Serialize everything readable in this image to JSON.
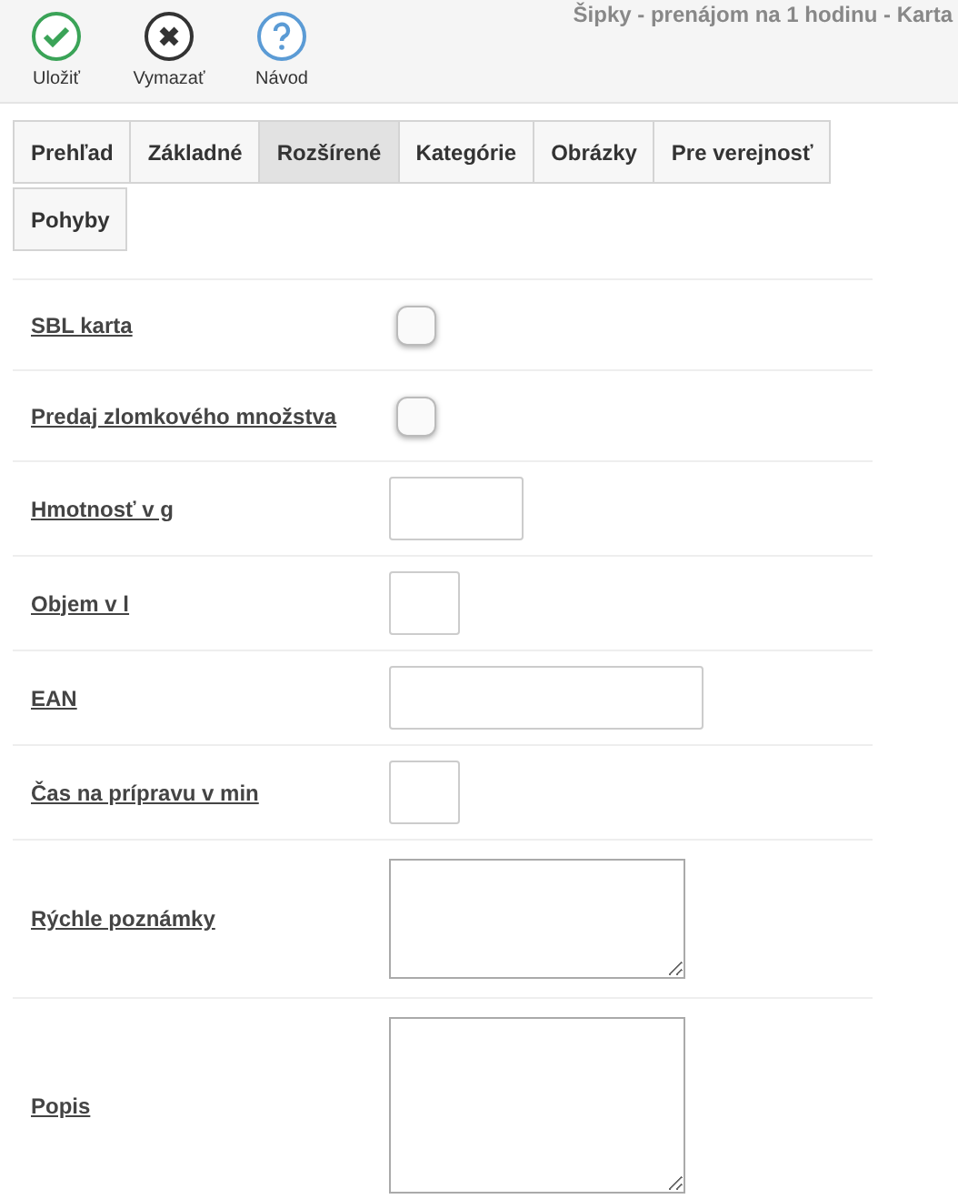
{
  "window": {
    "title": "Šipky - prenájom na 1 hodinu - Karta"
  },
  "toolbar": [
    {
      "kind": "save",
      "label": "Uložiť"
    },
    {
      "kind": "delete",
      "label": "Vymazať"
    },
    {
      "kind": "help",
      "label": "Návod"
    }
  ],
  "tabs": [
    {
      "label": "Prehľad",
      "selected": false
    },
    {
      "label": "Základné",
      "selected": false
    },
    {
      "label": "Rozšírené",
      "selected": true
    },
    {
      "label": "Kategórie",
      "selected": false
    },
    {
      "label": "Obrázky",
      "selected": false
    },
    {
      "label": "Pre verejnosť",
      "selected": false
    },
    {
      "label": "Pohyby",
      "selected": false
    }
  ],
  "fields": [
    {
      "label": "SBL karta",
      "kind": "checkbox",
      "checked": false
    },
    {
      "label": "Predaj zlomkového množstva",
      "kind": "checkbox",
      "checked": false
    },
    {
      "label": "Hmotnosť v g",
      "kind": "field"
    },
    {
      "label": "Objem v l",
      "kind": "shortfield"
    },
    {
      "label": "EAN",
      "kind": "widefield"
    },
    {
      "label": "Čas na prípravu v min",
      "kind": "shortfield"
    },
    {
      "label": "Rýchle poznámky",
      "kind": "notes"
    },
    {
      "label": "Popis",
      "kind": "textarea"
    }
  ]
}
